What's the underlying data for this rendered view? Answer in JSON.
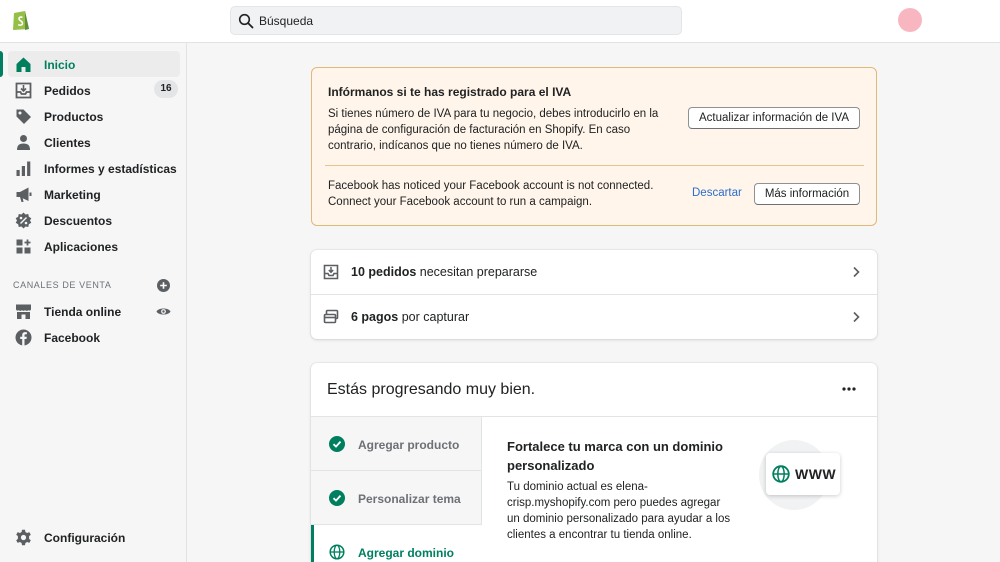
{
  "topbar": {
    "search_placeholder": "Búsqueda"
  },
  "sidebar": {
    "items": [
      {
        "label": "Inicio",
        "icon": "home-icon",
        "active": true
      },
      {
        "label": "Pedidos",
        "icon": "orders-icon",
        "badge": "16"
      },
      {
        "label": "Productos",
        "icon": "tag-icon"
      },
      {
        "label": "Clientes",
        "icon": "person-icon"
      },
      {
        "label": "Informes y estadísticas",
        "icon": "analytics-icon"
      },
      {
        "label": "Marketing",
        "icon": "megaphone-icon"
      },
      {
        "label": "Descuentos",
        "icon": "discount-icon"
      },
      {
        "label": "Aplicaciones",
        "icon": "apps-icon"
      }
    ],
    "sales_channels_label": "CANALES DE VENTA",
    "channels": [
      {
        "label": "Tienda online",
        "icon": "store-icon"
      },
      {
        "label": "Facebook",
        "icon": "facebook-icon"
      }
    ],
    "settings_label": "Configuración"
  },
  "banner": {
    "title": "Infórmanos si te has registrado para el IVA",
    "vat_body": "Si tienes número de IVA para tu negocio, debes introducirlo en la página de configuración de facturación en Shopify. En caso contrario, indícanos que no tienes número de IVA.",
    "vat_button": "Actualizar información de IVA",
    "fb_body": "Facebook has noticed your Facebook account is not connected. Connect your Facebook account to run a campaign.",
    "fb_dismiss": "Descartar",
    "fb_more": "Más información"
  },
  "orders": {
    "row1_bold": "10 pedidos",
    "row1_text": " necesitan prepararse",
    "row2_bold": "6 pagos",
    "row2_text": " por capturar"
  },
  "progress": {
    "heading": "Estás progresando muy bien.",
    "steps": [
      {
        "label": "Agregar producto",
        "done": true
      },
      {
        "label": "Personalizar tema",
        "done": true
      },
      {
        "label": "Agregar dominio",
        "active": true
      }
    ],
    "detail_title": "Fortalece tu marca con un dominio personalizado",
    "detail_body": "Tu dominio actual es elena-crisp.myshopify.com pero puedes agregar un dominio personalizado para ayudar a los clientes a encontrar tu tienda online.",
    "www_label": "WWW"
  },
  "colors": {
    "accent": "#008060",
    "banner_bg": "#fff5ea",
    "banner_border": "#e1b878",
    "link": "#2c6ecb"
  }
}
